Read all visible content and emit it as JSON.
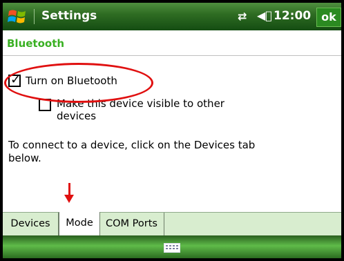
{
  "title_bar": {
    "title": "Settings",
    "clock": "12:00",
    "ok_label": "ok",
    "connectivity_icon": "connectivity-icon",
    "volume_icon": "volume-icon",
    "start_icon": "windows-flag-icon"
  },
  "page": {
    "heading": "Bluetooth"
  },
  "options": {
    "turn_on_label": "Turn on Bluetooth",
    "turn_on_checked": true,
    "visible_label": "Make this device visible to other devices",
    "visible_checked": false
  },
  "info_text": "To connect to a device, click on the Devices tab below.",
  "tabs": [
    {
      "label": "Devices",
      "selected": false
    },
    {
      "label": "Mode",
      "selected": true
    },
    {
      "label": "COM Ports",
      "selected": false
    }
  ],
  "softkey_bar": {
    "input_icon": "keyboard-icon"
  },
  "annotations": {
    "highlight_color": "#e01010"
  },
  "colors": {
    "heading": "#39b022",
    "title_bar": "#2f6d23"
  }
}
